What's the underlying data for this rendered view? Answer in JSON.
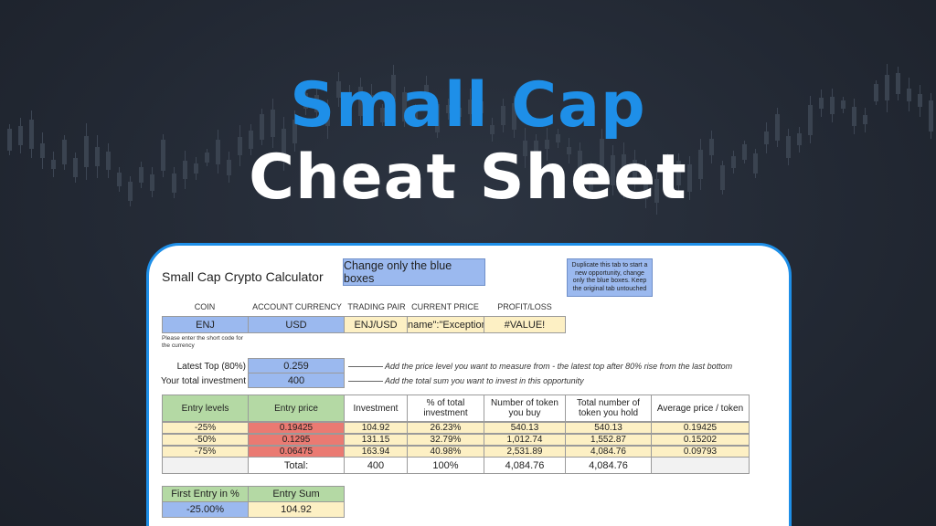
{
  "headline": {
    "line1": "Small Cap",
    "line2": "Cheat Sheet"
  },
  "sheet": {
    "title": "Small Cap Crypto Calculator",
    "blue_note": "Change only the blue boxes",
    "duplicate_note": "Duplicate this tab to start a new opportunity, change only the blue boxes. Keep the original tab untouched",
    "top_headers": [
      "COIN",
      "ACCOUNT CURRENCY",
      "TRADING PAIR",
      "CURRENT PRICE",
      "PROFIT/LOSS"
    ],
    "top_values": [
      "ENJ",
      "USD",
      "ENJ/USD",
      "name\":\"Exception",
      "#VALUE!"
    ],
    "short_code_note": "Please enter the short code for the currency",
    "latest_top": {
      "label": "Latest Top (80%)",
      "value": "0.259",
      "hint": "Add the price level you want to measure from - the latest top after 80% rise from the last bottom"
    },
    "investment": {
      "label": "Your total investment",
      "value": "400",
      "hint": "Add the total sum you want to invest in this opportunity"
    },
    "table": {
      "headers": [
        "Entry levels",
        "Entry price",
        "Investment",
        "% of total investment",
        "Number of token you buy",
        "Total number of token you hold",
        "Average price / token"
      ],
      "rows": [
        [
          "-25%",
          "0.19425",
          "104.92",
          "26.23%",
          "540.13",
          "540.13",
          "0.19425"
        ],
        [
          "-50%",
          "0.1295",
          "131.15",
          "32.79%",
          "1,012.74",
          "1,552.87",
          "0.15202"
        ],
        [
          "-75%",
          "0.06475",
          "163.94",
          "40.98%",
          "2,531.89",
          "4,084.76",
          "0.09793"
        ]
      ],
      "total": [
        "",
        "Total:",
        "400",
        "100%",
        "4,084.76",
        "4,084.76",
        ""
      ]
    },
    "first_entry": {
      "label": "First Entry in %",
      "value": "-25.00%"
    },
    "entry_sum": {
      "label": "Entry Sum",
      "value": "104.92"
    }
  },
  "colors": {
    "accent_blue": "#1e8fe8",
    "input_blue": "#9bb9ef",
    "output_yellow": "#fdf0c4",
    "header_green": "#b4d9a4",
    "entry_red": "#ea7a72"
  }
}
